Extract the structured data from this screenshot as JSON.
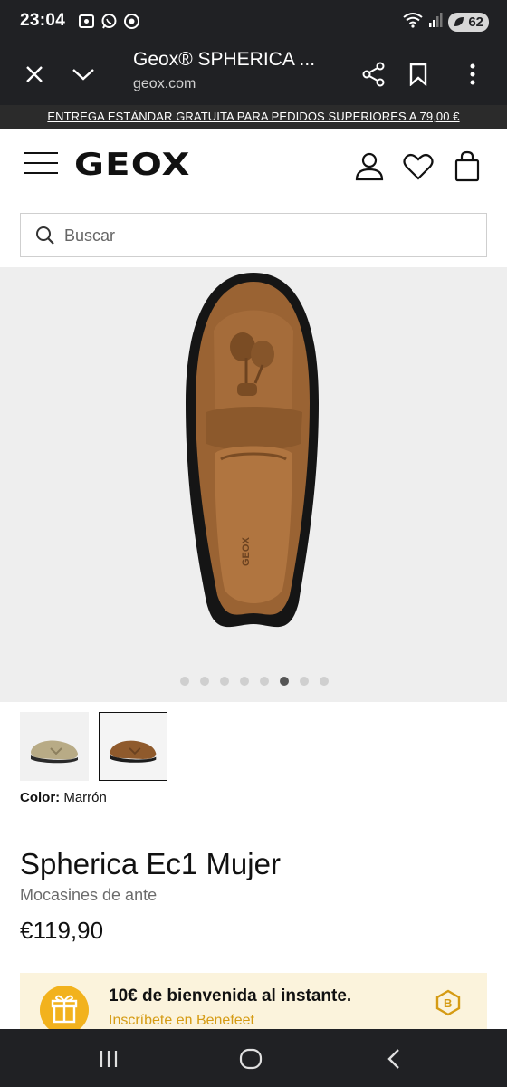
{
  "status_bar": {
    "time": "23:04",
    "battery": "62"
  },
  "browser": {
    "title": "Geox® SPHERICA ...",
    "url": "geox.com"
  },
  "promo": {
    "text": "ENTREGA ESTÁNDAR GRATUITA PARA PEDIDOS SUPERIORES A 79,00 €"
  },
  "header": {
    "logo": "GEOX"
  },
  "search": {
    "placeholder": "Buscar"
  },
  "carousel": {
    "dots_total": 8,
    "active_index": 5
  },
  "product": {
    "color_label": "Color:",
    "color_value": "Marrón",
    "title": "Spherica Ec1 Mujer",
    "subtitle": "Mocasines de ante",
    "price": "€119,90"
  },
  "benefeet": {
    "title": "10€ de bienvenida al instante.",
    "link": "Inscríbete en Benefeet"
  },
  "colors": {
    "accent": "#f2b21d",
    "dark_bar": "#202124",
    "product_brown": "#9a6333"
  }
}
